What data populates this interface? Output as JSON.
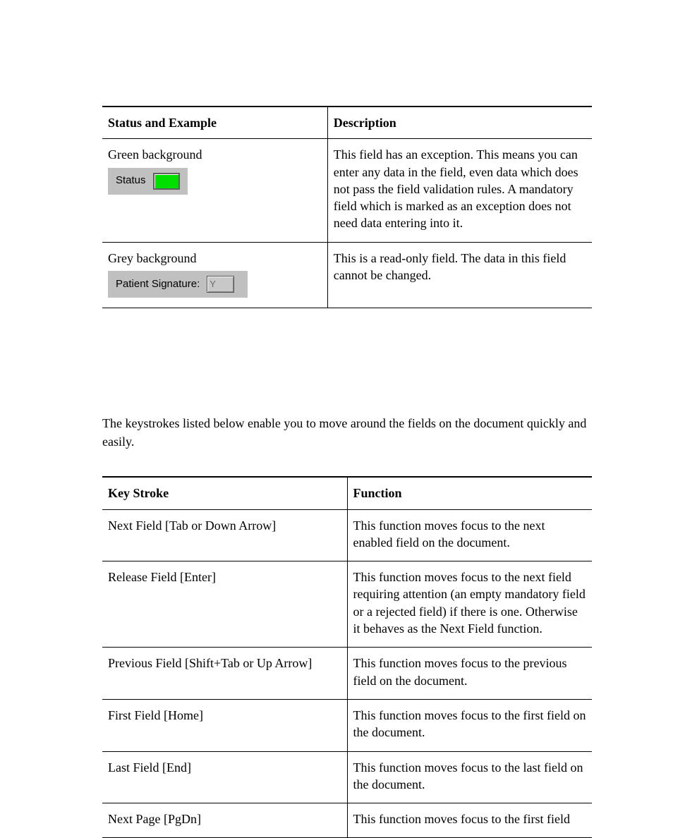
{
  "table1": {
    "headers": [
      "Status and Example",
      "Description"
    ],
    "rows": [
      {
        "status_title": "Green background",
        "widget_label": "Status",
        "widget_type": "green",
        "description": "This field has an exception. This means you can enter any data in the field, even data which does not pass the field validation rules. A mandatory field which is marked as an exception does not need data entering into it."
      },
      {
        "status_title": "Grey background",
        "widget_label": "Patient Signature:",
        "widget_type": "readonly",
        "widget_value": "Y",
        "description": "This is a read-only field. The data in this field cannot be changed."
      }
    ]
  },
  "intro_text": "The keystrokes listed below enable you to move around the fields on the document quickly and easily.",
  "table2": {
    "headers": [
      "Key Stroke",
      "Function"
    ],
    "rows": [
      {
        "key": "Next Field [Tab or Down Arrow]",
        "fn": "This function moves focus to the next enabled field on the document."
      },
      {
        "key": "Release Field [Enter]",
        "fn": "This function moves focus to the next field requiring attention (an empty mandatory field or a rejected field) if there is one. Otherwise it behaves as the Next Field function."
      },
      {
        "key": "Previous Field [Shift+Tab or Up Arrow]",
        "fn": "This function moves focus to the previous field on the document."
      },
      {
        "key": "First Field [Home]",
        "fn": "This function moves focus to the first field on the document."
      },
      {
        "key": "Last Field [End]",
        "fn": "This function moves focus to the last field on the document."
      },
      {
        "key": "Next Page [PgDn]",
        "fn": "This function moves focus to the first field"
      }
    ]
  }
}
